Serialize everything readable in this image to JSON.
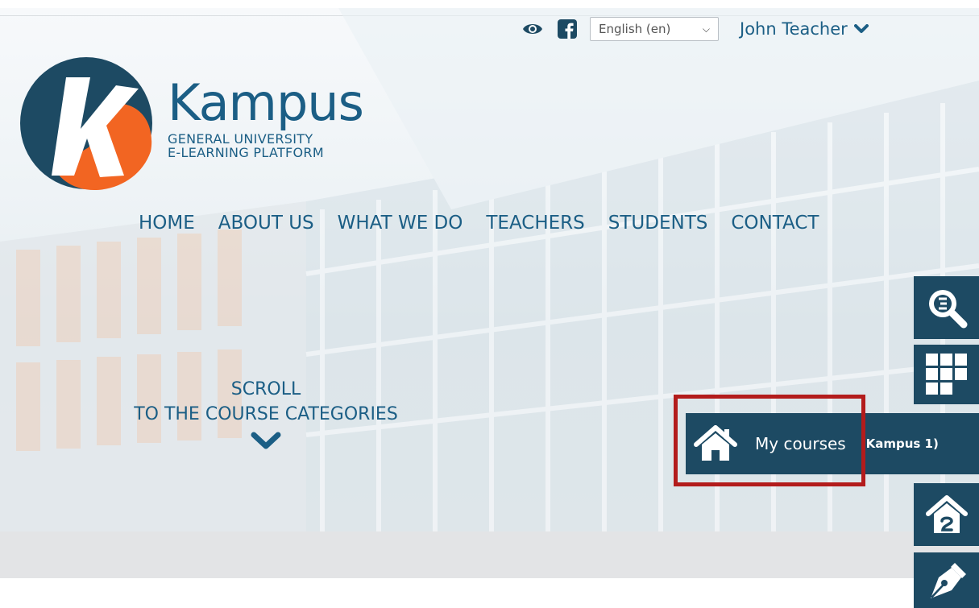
{
  "header": {
    "language_select": {
      "value": "English (en)"
    },
    "user_menu": {
      "name": "John Teacher"
    }
  },
  "brand": {
    "name": "Kampus",
    "subtitle_line1": "GENERAL UNIVERSITY",
    "subtitle_line2": "E-LEARNING PLATFORM"
  },
  "nav": {
    "items": [
      "HOME",
      "ABOUT US",
      "WHAT WE DO",
      "TEACHERS",
      "STUDENTS",
      "CONTACT"
    ]
  },
  "scroll_prompt": {
    "line1": "SCROLL",
    "line2": "TO THE COURSE CATEGORIES"
  },
  "sidebar": {
    "my_courses": {
      "label": "My courses",
      "context": "(Kampus 1)"
    },
    "icons": [
      "search-course-icon",
      "grid-categories-icon",
      "home-page-icon",
      "pen-edit-icon"
    ]
  },
  "colors": {
    "primary": "#1b5e85",
    "sidebar_bg": "#1d4a63",
    "logo_orange": "#f26522",
    "highlight_red": "#b31c1c"
  }
}
